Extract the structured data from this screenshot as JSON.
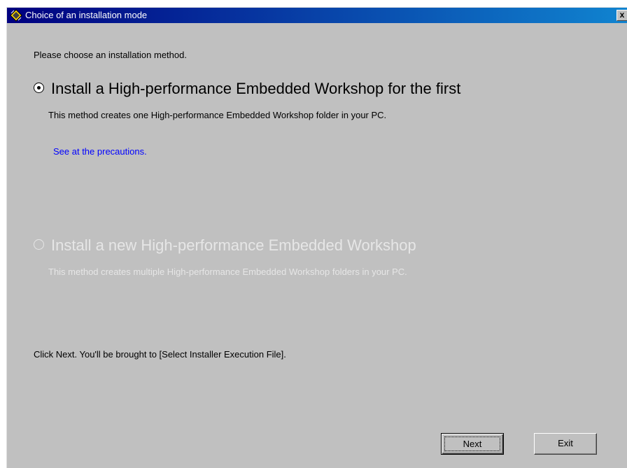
{
  "window": {
    "title": "Choice of an installation mode",
    "title_icon": "installer-chip-icon",
    "close_label": "x"
  },
  "main": {
    "intro": "Please choose an installation method.",
    "options": [
      {
        "label": "Install a High-performance Embedded Workshop for the first",
        "description": "This method creates one High-performance Embedded Workshop folder in your PC.",
        "selected": true,
        "enabled": true
      },
      {
        "label": "Install a new High-performance Embedded Workshop",
        "description": "This method creates multiple High-performance Embedded Workshop folders in your PC.",
        "selected": false,
        "enabled": false
      }
    ],
    "precautions_link": "See at the precautions.",
    "footer_note": "Click Next. You'll be brought to [Select Installer Execution File]."
  },
  "buttons": {
    "next": "Next",
    "exit": "Exit"
  },
  "colors": {
    "dialog_bg": "#c0c0c0",
    "title_start": "#000080",
    "title_end": "#1084d0",
    "link": "#0000ff",
    "disabled_text": "#e6e6e6"
  }
}
